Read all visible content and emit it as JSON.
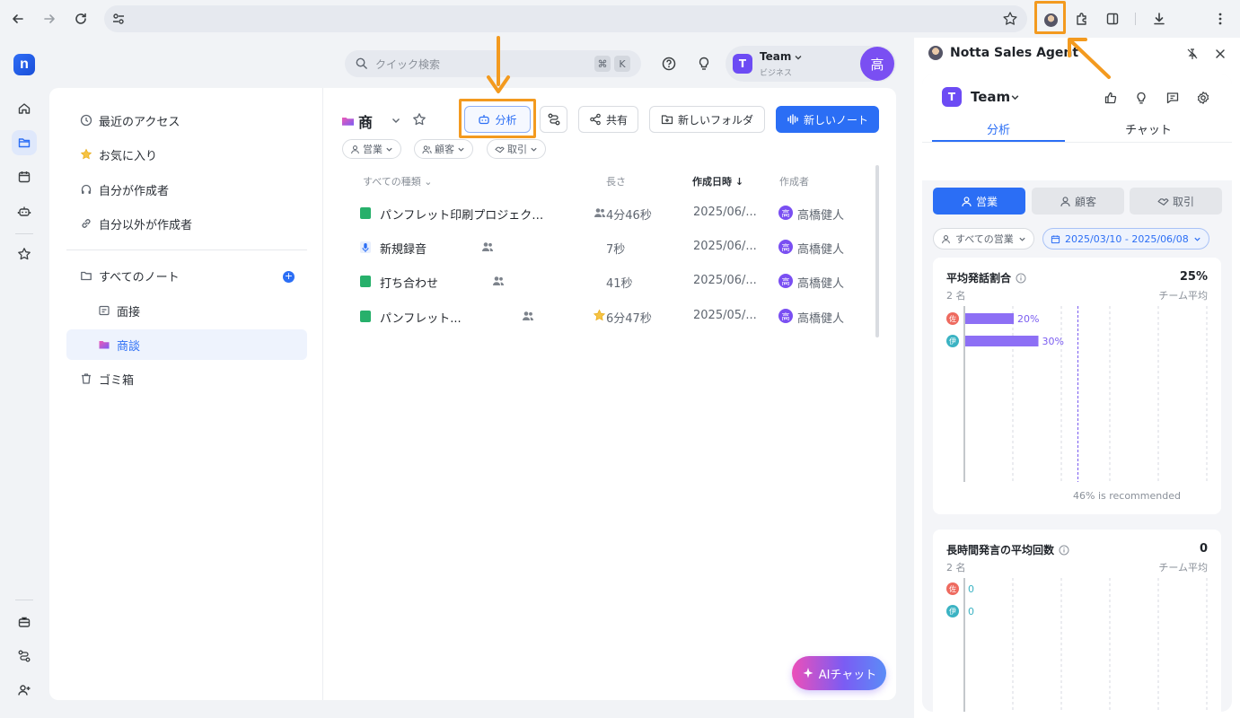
{
  "browser": {
    "back_icon": "arrow-left-icon",
    "forward_icon": "arrow-right-icon",
    "reload_icon": "reload-icon",
    "bookmark_icon": "star-icon",
    "extensions_icon": "puzzle-icon",
    "sidepanel_icon": "side-panel-icon",
    "download_icon": "download-icon",
    "menu_icon": "more-vert-icon"
  },
  "topbar": {
    "search_placeholder": "クイック検索",
    "kbd_cmd": "⌘",
    "kbd_key": "K",
    "team_name": "Team",
    "team_plan": "ビジネス",
    "team_badge": "T",
    "avatar_initial": "高"
  },
  "sidebar": {
    "items": [
      {
        "label": "最近のアクセス",
        "icon": "clock-icon"
      },
      {
        "label": "お気に入り",
        "icon": "star-icon"
      },
      {
        "label": "自分が作成者",
        "icon": "headphones-icon"
      },
      {
        "label": "自分以外が作成者",
        "icon": "link-icon"
      }
    ],
    "all_notes": "すべてのノート",
    "folders": [
      {
        "label": "面接",
        "active": false
      },
      {
        "label": "商談",
        "active": true
      }
    ],
    "trash": "ゴミ箱"
  },
  "main": {
    "folder_title": "商",
    "buttons": {
      "analyze": "分析",
      "share": "共有",
      "new_folder": "新しいフォルダ",
      "new_note": "新しいノート"
    },
    "chips": [
      "営業",
      "顧客",
      "取引"
    ],
    "columns": {
      "type": "すべての種類",
      "length": "長さ",
      "created": "作成日時",
      "creator": "作成者"
    },
    "rows": [
      {
        "name": "パンフレット印刷プロジェク…",
        "length": "4分46秒",
        "date": "2025/06/...",
        "creator": "高橋健人",
        "creator_initial": "高",
        "icon": "doc-icon",
        "starred": false
      },
      {
        "name": "新規録音",
        "length": "7秒",
        "date": "2025/06/...",
        "creator": "高橋健人",
        "creator_initial": "高",
        "icon": "mic-icon",
        "starred": false
      },
      {
        "name": "打ち合わせ",
        "length": "41秒",
        "date": "2025/06/...",
        "creator": "高橋健人",
        "creator_initial": "高",
        "icon": "doc-icon",
        "starred": false
      },
      {
        "name": "パンフレット...",
        "length": "6分47秒",
        "date": "2025/05/...",
        "creator": "高橋健人",
        "creator_initial": "高",
        "icon": "doc-icon",
        "starred": true
      }
    ],
    "ai_chat": "AIチャット"
  },
  "panel": {
    "title": "Notta Sales Agent",
    "team": "Team",
    "team_badge": "T",
    "tabs": [
      "分析",
      "チャット"
    ],
    "segments": [
      "営業",
      "顧客",
      "取引"
    ],
    "filter_all": "すべての営業",
    "date_range": "2025/03/10 - 2025/06/08",
    "metric1": {
      "title": "平均発話割合",
      "value": "25%",
      "sub": "2 名",
      "right": "チーム平均",
      "recommend": "46% is recommended",
      "bars": [
        {
          "initial": "佐",
          "color": "#ee6a5f",
          "value": 20,
          "label": "20%"
        },
        {
          "initial": "伊",
          "color": "#3bb3c3",
          "value": 30,
          "label": "30%"
        }
      ],
      "recommended_value": 46
    },
    "metric2": {
      "title": "長時間発言の平均回数",
      "value": "0",
      "sub": "2 名",
      "right": "チーム平均",
      "bars": [
        {
          "initial": "佐",
          "color": "#ee6a5f",
          "label": "0"
        },
        {
          "initial": "伊",
          "color": "#3bb3c3",
          "label": "0"
        }
      ]
    }
  },
  "colors": {
    "accent": "#2b6ef5",
    "highlight": "#f39a1f",
    "purple": "#7a4ff2"
  }
}
